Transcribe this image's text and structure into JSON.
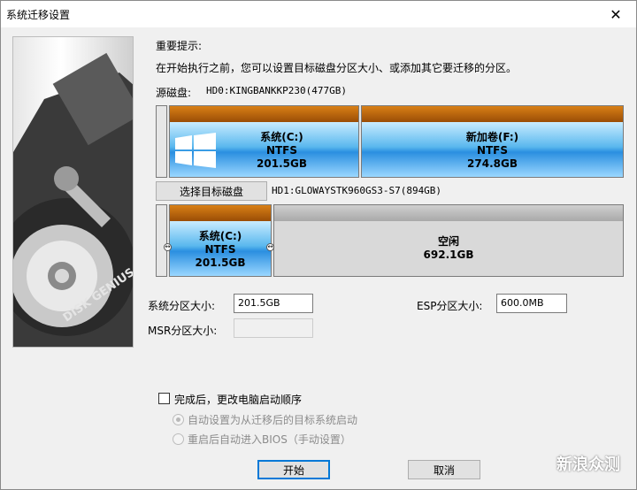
{
  "window": {
    "title": "系统迁移设置",
    "close_glyph": "✕"
  },
  "notice": {
    "title": "重要提示:",
    "text": "在开始执行之前，您可以设置目标磁盘分区大小、或添加其它要迁移的分区。"
  },
  "source": {
    "label": "源磁盘:",
    "disk": "HD0:KINGBANKKP230(477GB)",
    "partitions": [
      {
        "name": "系统(C:)",
        "fs": "NTFS",
        "size": "201.5GB"
      },
      {
        "name": "新加卷(F:)",
        "fs": "NTFS",
        "size": "274.8GB"
      }
    ]
  },
  "target": {
    "select_button": "选择目标磁盘",
    "disk": "HD1:GLOWAYSTK960GS3-S7(894GB)",
    "partitions": [
      {
        "name": "系统(C:)",
        "fs": "NTFS",
        "size": "201.5GB"
      },
      {
        "name": "空闲",
        "size": "692.1GB"
      }
    ]
  },
  "fields": {
    "system_label": "系统分区大小:",
    "system_value": "201.5GB",
    "esp_label": "ESP分区大小:",
    "esp_value": "600.0MB",
    "msr_label": "MSR分区大小:",
    "msr_value": ""
  },
  "options": {
    "change_boot_label": "完成后，更改电脑启动顺序",
    "change_boot_checked": false,
    "radio_auto": "自动设置为从迁移后的目标系统启动",
    "radio_manual": "重启后自动进入BIOS（手动设置）"
  },
  "buttons": {
    "start": "开始",
    "cancel": "取消"
  },
  "watermark": "新浪众测",
  "colors": {
    "cap": "#c06a0e",
    "accent": "#0078d7",
    "partition_blue": "#2a8fe0"
  }
}
